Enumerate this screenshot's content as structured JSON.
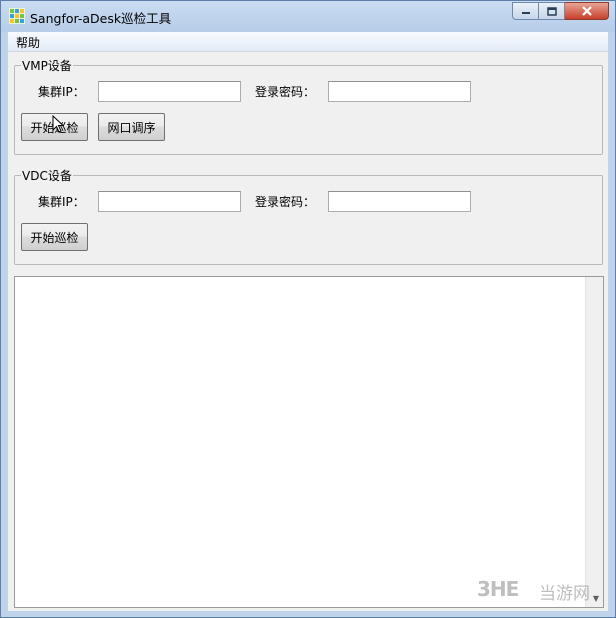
{
  "window": {
    "title": "Sangfor-aDesk巡检工具"
  },
  "menu": {
    "help_label": "帮助"
  },
  "vmp_group": {
    "title": "VMP设备",
    "cluster_ip_label": "集群IP：",
    "cluster_ip_value": "",
    "password_label": "登录密码：",
    "password_value": "",
    "start_button_label": "开始巡检",
    "port_order_button_label": "网口调序"
  },
  "vdc_group": {
    "title": "VDC设备",
    "cluster_ip_label": "集群IP：",
    "cluster_ip_value": "",
    "password_label": "登录密码：",
    "password_value": "",
    "start_button_label": "开始巡检"
  },
  "output": {
    "text": ""
  },
  "watermark": {
    "logo": "3HE",
    "text": "当游网"
  },
  "colors": {
    "titlebar": "#c9dcf2",
    "close_button": "#c7412c",
    "face": "#f0f0f0"
  }
}
